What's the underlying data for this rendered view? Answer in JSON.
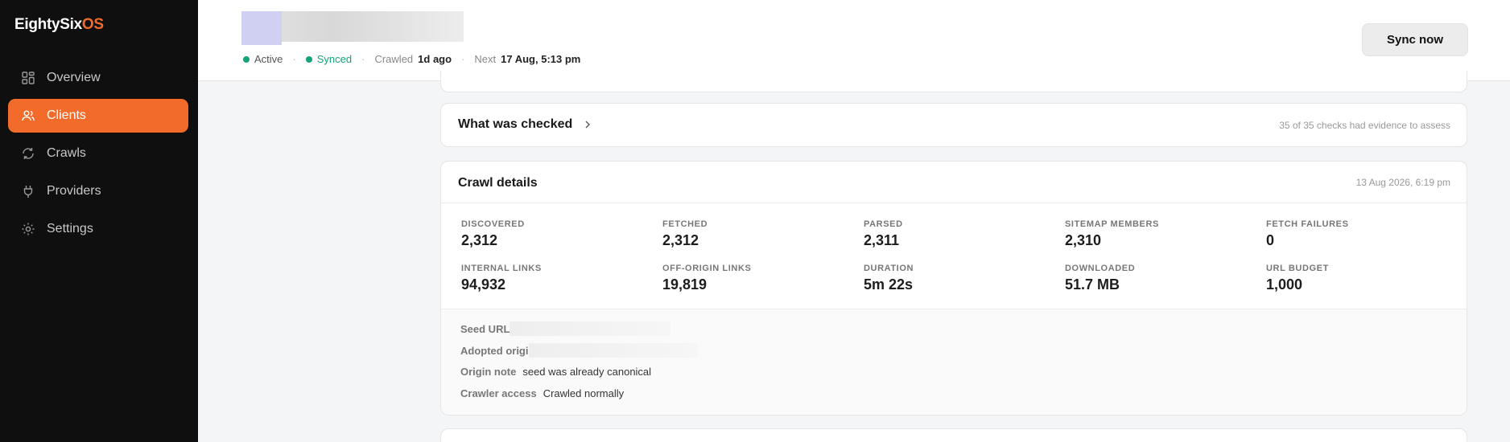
{
  "brand": {
    "prefix": "EightySix",
    "suffix": "OS"
  },
  "sidebar": {
    "items": [
      {
        "label": "Overview",
        "icon": "grid-icon",
        "active": false
      },
      {
        "label": "Clients",
        "icon": "users-icon",
        "active": true
      },
      {
        "label": "Crawls",
        "icon": "refresh-icon",
        "active": false
      },
      {
        "label": "Providers",
        "icon": "plug-icon",
        "active": false
      },
      {
        "label": "Settings",
        "icon": "gear-icon",
        "active": false
      }
    ]
  },
  "header": {
    "status": "Active",
    "sync_state": "Synced",
    "crawled_label": "Crawled",
    "crawled_value": "1d ago",
    "next_label": "Next",
    "next_value": "17 Aug, 5:13 pm",
    "sync_button": "Sync now"
  },
  "checked": {
    "title": "What was checked",
    "note": "35 of 35 checks had evidence to assess"
  },
  "crawl": {
    "title": "Crawl details",
    "date": "13 Aug 2026, 6:19 pm",
    "stats": [
      {
        "label": "DISCOVERED",
        "value": "2,312"
      },
      {
        "label": "FETCHED",
        "value": "2,312"
      },
      {
        "label": "PARSED",
        "value": "2,311"
      },
      {
        "label": "SITEMAP MEMBERS",
        "value": "2,310"
      },
      {
        "label": "FETCH FAILURES",
        "value": "0"
      },
      {
        "label": "INTERNAL LINKS",
        "value": "94,932"
      },
      {
        "label": "OFF-ORIGIN LINKS",
        "value": "19,819"
      },
      {
        "label": "DURATION",
        "value": "5m 22s"
      },
      {
        "label": "DOWNLOADED",
        "value": "51.7 MB"
      },
      {
        "label": "URL BUDGET",
        "value": "1,000"
      }
    ],
    "details": {
      "seed_url_label": "Seed URL",
      "adopted_origin_label": "Adopted origi",
      "origin_note_label": "Origin note",
      "origin_note_value": "seed was already canonical",
      "crawler_access_label": "Crawler access",
      "crawler_access_value": "Crawled normally"
    }
  },
  "colors": {
    "accent": "#f26b2a",
    "status_green": "#12a37a",
    "sidebar_bg": "#0f0f0f"
  }
}
